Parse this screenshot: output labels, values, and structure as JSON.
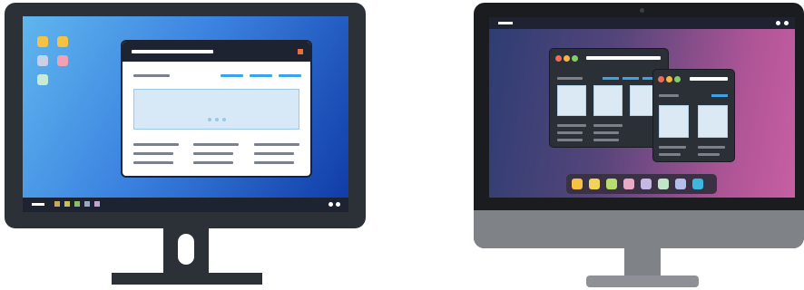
{
  "illustration": {
    "left_monitor": {
      "desktop_icons": [
        "#f5c244",
        "#f5c244",
        "#c9d1e8",
        "#f0a1b4",
        "#c8ecd3"
      ],
      "taskbar_icons": [
        "#c9a85e",
        "#c9c15e",
        "#8cbd6b",
        "#9aa7c9",
        "#c3a4cf"
      ],
      "window_close_color": "#f26b3a",
      "screen_colors": [
        "#5fb6ee",
        "#0f3aa6"
      ]
    },
    "right_monitor": {
      "traffic_lights": [
        "#f06a5a",
        "#f5b544",
        "#7fcf6a"
      ],
      "dock_icons": [
        "#f5c244",
        "#f2d35a",
        "#b8dd6a",
        "#e7a9c6",
        "#c6b8e4",
        "#bfe6c9",
        "#b4c0ea",
        "#3cb7e0"
      ],
      "screen_colors": [
        "#2d3d73",
        "#c75fa3"
      ]
    }
  }
}
